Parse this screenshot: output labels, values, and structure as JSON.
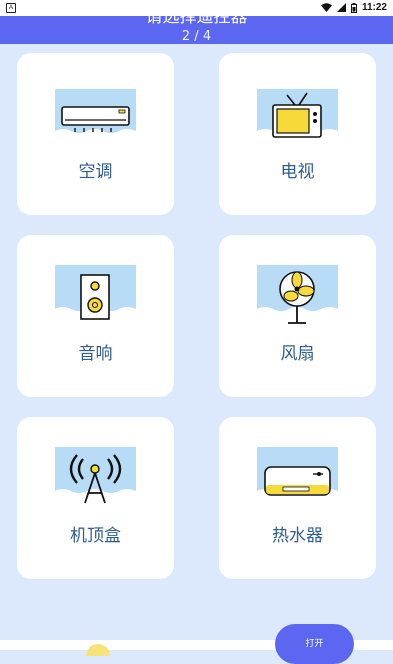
{
  "status_bar": {
    "time": "11:22"
  },
  "header": {
    "title": "请选择遥控器",
    "page_indicator": "2 / 4"
  },
  "devices": [
    {
      "label": "空调",
      "icon": "air-conditioner-icon"
    },
    {
      "label": "电视",
      "icon": "tv-icon"
    },
    {
      "label": "音响",
      "icon": "speaker-icon"
    },
    {
      "label": "风扇",
      "icon": "fan-icon"
    },
    {
      "label": "机顶盒",
      "icon": "set-top-box-icon"
    },
    {
      "label": "热水器",
      "icon": "water-heater-icon"
    }
  ],
  "open_button": {
    "label": "打开"
  },
  "colors": {
    "accent": "#5b67f0",
    "background": "#dce8fb",
    "label": "#2f5d8f",
    "icon_yellow": "#f6da3a",
    "icon_sky": "#b8dcf6"
  }
}
